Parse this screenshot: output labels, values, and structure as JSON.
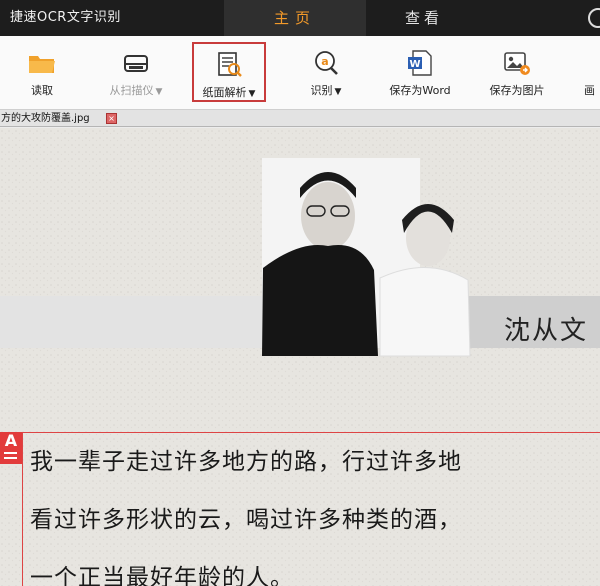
{
  "window": {
    "title": "捷速OCR文字识别"
  },
  "tabs": [
    {
      "label": "主页",
      "active": true
    },
    {
      "label": "查看",
      "active": false
    }
  ],
  "toolbar": {
    "read_label": "读取",
    "scanner_label": "从扫描仪",
    "paper_label": "纸面解析",
    "recognize_label": "识别",
    "save_word_label": "保存为Word",
    "save_image_label": "保存为图片",
    "edge_label": "画",
    "caret": "▼"
  },
  "file_tab": {
    "name": "方的大攻防覆盖.jpg",
    "close": "×"
  },
  "document": {
    "caption": "沈从文",
    "marker": "A",
    "lines": [
      "我一辈子走过许多地方的路，行过许多地",
      "看过许多形状的云，喝过许多种类的酒，",
      "一个正当最好年龄的人。"
    ]
  },
  "colors": {
    "titlebar": "#1d1d1d",
    "active_tab_text": "#f39a2a",
    "highlight_border": "#c83b3b",
    "marker_red": "#e23b3b"
  }
}
